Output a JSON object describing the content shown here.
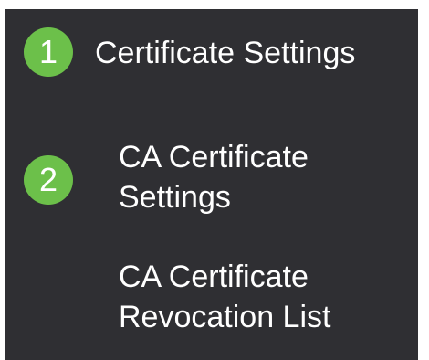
{
  "menu": {
    "colors": {
      "background": "#2f2f33",
      "text": "#ffffff",
      "badge": "#6cc04a"
    },
    "badges": [
      "1",
      "2"
    ],
    "items": [
      {
        "line1": "Certificate Settings",
        "line2": ""
      },
      {
        "line1": "CA Certificate",
        "line2": "Settings"
      },
      {
        "line1": "CA Certificate",
        "line2": "Revocation List"
      }
    ]
  }
}
